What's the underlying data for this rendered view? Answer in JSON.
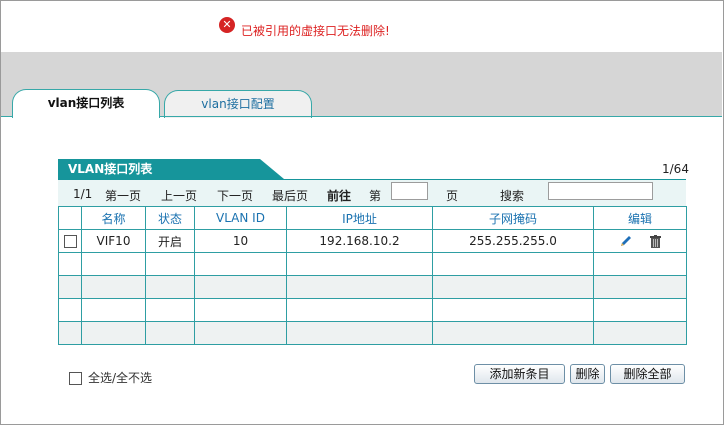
{
  "alert": {
    "icon": "error-circle-icon",
    "message": "已被引用的虚接口无法删除!"
  },
  "tabs": [
    {
      "label": "vlan接口列表",
      "active": true
    },
    {
      "label": "vlan接口配置",
      "active": false
    }
  ],
  "panel": {
    "title": "VLAN接口列表",
    "page_count": "1/64"
  },
  "pager": {
    "current": "1/1",
    "first": "第一页",
    "prev": "上一页",
    "next": "下一页",
    "last": "最后页",
    "goto": "前往",
    "di": "第",
    "page_input": "",
    "ye": "页",
    "search_label": "搜索",
    "search_value": ""
  },
  "table": {
    "headers": [
      "",
      "名称",
      "状态",
      "VLAN ID",
      "IP地址",
      "子网掩码",
      "编辑"
    ],
    "rows": [
      {
        "name": "VIF10",
        "status": "开启",
        "vlan_id": "10",
        "ip": "192.168.10.2",
        "mask": "255.255.255.0"
      }
    ]
  },
  "footer": {
    "select_all": "全选/全不选",
    "add_button": "添加新条目",
    "delete_button": "删除",
    "delete_all_button": "删除全部"
  },
  "colors": {
    "accent": "#16959b",
    "alert": "#d22222",
    "link": "#1a72b0"
  }
}
